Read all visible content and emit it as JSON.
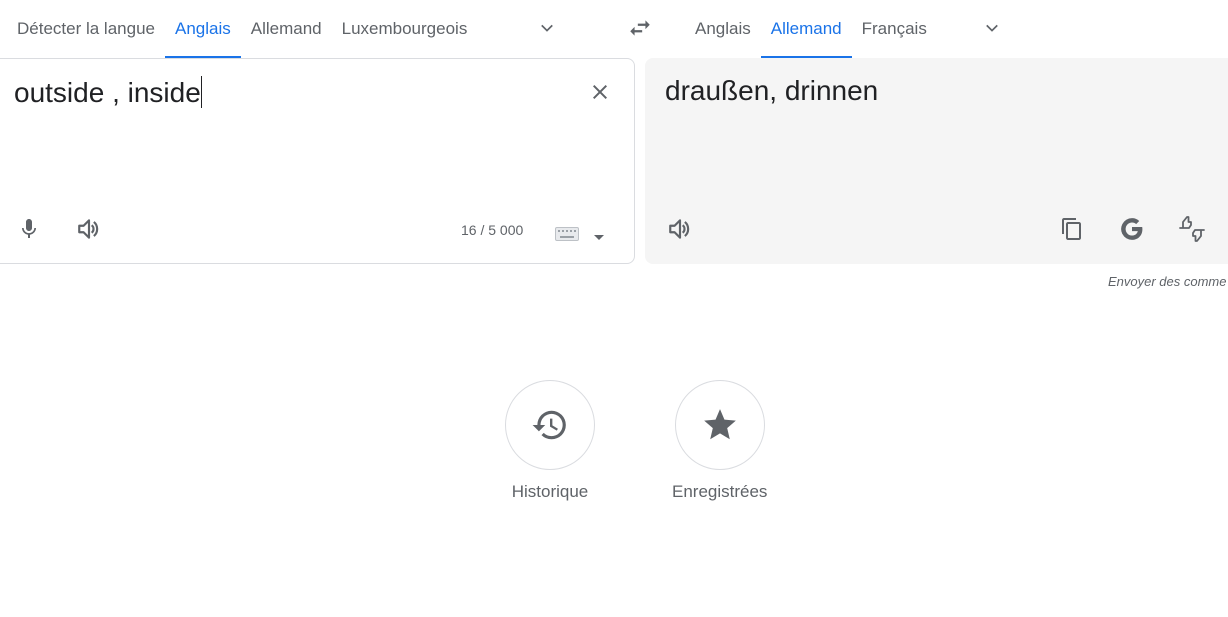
{
  "source_languages": {
    "tabs": [
      "Détecter la langue",
      "Anglais",
      "Allemand",
      "Luxembourgeois"
    ],
    "active_index": 1,
    "more_icon": "chevron-down-icon"
  },
  "swap_icon": "swap-arrows-icon",
  "target_languages": {
    "tabs": [
      "Anglais",
      "Allemand",
      "Français"
    ],
    "active_index": 1,
    "more_icon": "chevron-down-icon"
  },
  "source": {
    "text": "outside , inside",
    "char_count": "16 / 5 000",
    "icons": [
      "close-icon",
      "microphone-icon",
      "speaker-icon",
      "keyboard-icon",
      "caret-down-icon"
    ]
  },
  "target": {
    "text": "draußen, drinnen",
    "icons": [
      "speaker-icon",
      "copy-icon",
      "google-g-icon",
      "thumbs-rate-icon"
    ]
  },
  "feedback_label": "Envoyer des comme",
  "shortcuts": [
    {
      "label": "Historique",
      "icon": "history-icon"
    },
    {
      "label": "Enregistrées",
      "icon": "star-icon"
    }
  ],
  "colors": {
    "accent": "#1a73e8",
    "text": "#202124",
    "muted": "#5f6368",
    "target_bg": "#f5f5f5"
  }
}
